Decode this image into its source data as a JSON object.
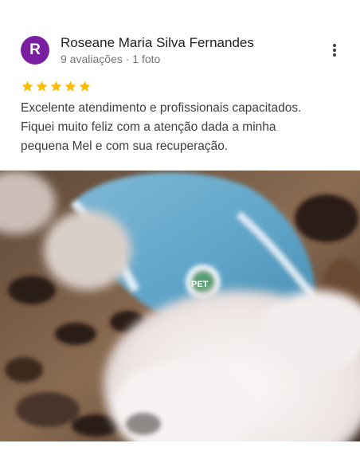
{
  "reviewer": {
    "initial": "R",
    "name": "Roseane Maria Silva Fernandes",
    "stats": "9 avaliações · 1 foto",
    "avatar_color": "#7b1fa2"
  },
  "rating": {
    "stars": 5,
    "max": 5,
    "star_color": "#fbbc04"
  },
  "review": {
    "line1": "Excelente atendimento e profissionais capacitados.",
    "line2": "Fiquei muito feliz com a atenção dada a minha",
    "line3": "pequena Mel e com sua recuperação."
  },
  "photo": {
    "logo_text": "PET"
  },
  "icons": {
    "more": "more-vert-icon",
    "star": "star-icon"
  }
}
